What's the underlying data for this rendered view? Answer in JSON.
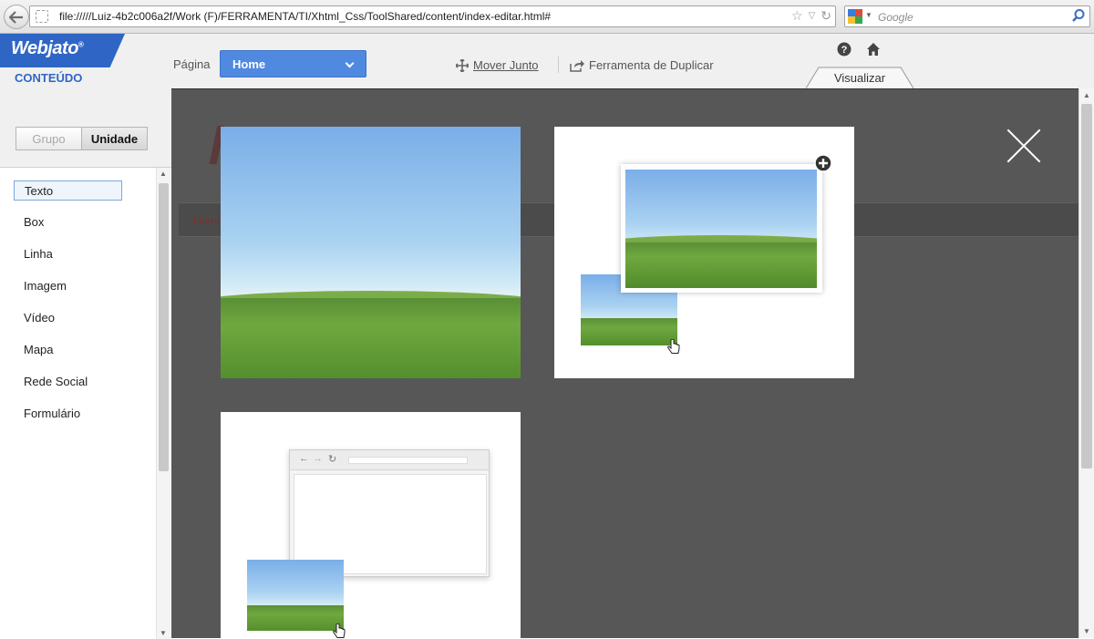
{
  "browser": {
    "url": "file://///Luiz-4b2c006a2f/Work  (F)/FERRAMENTA/TI/Xhtml_Css/ToolShared/content/index-editar.html#",
    "search_placeholder": "Google"
  },
  "header": {
    "logo_text": "Webjato",
    "logo_reg": "®",
    "section_title": "CONTEÚDO",
    "page_label": "Página",
    "page_select_value": "Home",
    "move_together_label": "Mover Junto",
    "duplicate_label": "Ferramenta de Duplicar",
    "preview_tab_label": "Visualizar"
  },
  "panel": {
    "segment": [
      {
        "label": "Grupo",
        "active": false
      },
      {
        "label": "Unidade",
        "active": true
      }
    ],
    "items": [
      {
        "label": "Texto",
        "selected": true
      },
      {
        "label": "Box",
        "selected": false
      },
      {
        "label": "Linha",
        "selected": false
      },
      {
        "label": "Imagem",
        "selected": false
      },
      {
        "label": "Vídeo",
        "selected": false
      },
      {
        "label": "Mapa",
        "selected": false
      },
      {
        "label": "Rede Social",
        "selected": false
      },
      {
        "label": "Formulário",
        "selected": false
      }
    ]
  },
  "canvas": {
    "background_breadcrumb": "Home"
  },
  "colors": {
    "accent": "#2f66c5",
    "select_bg": "#4f89e0",
    "overlay": "#575757"
  }
}
